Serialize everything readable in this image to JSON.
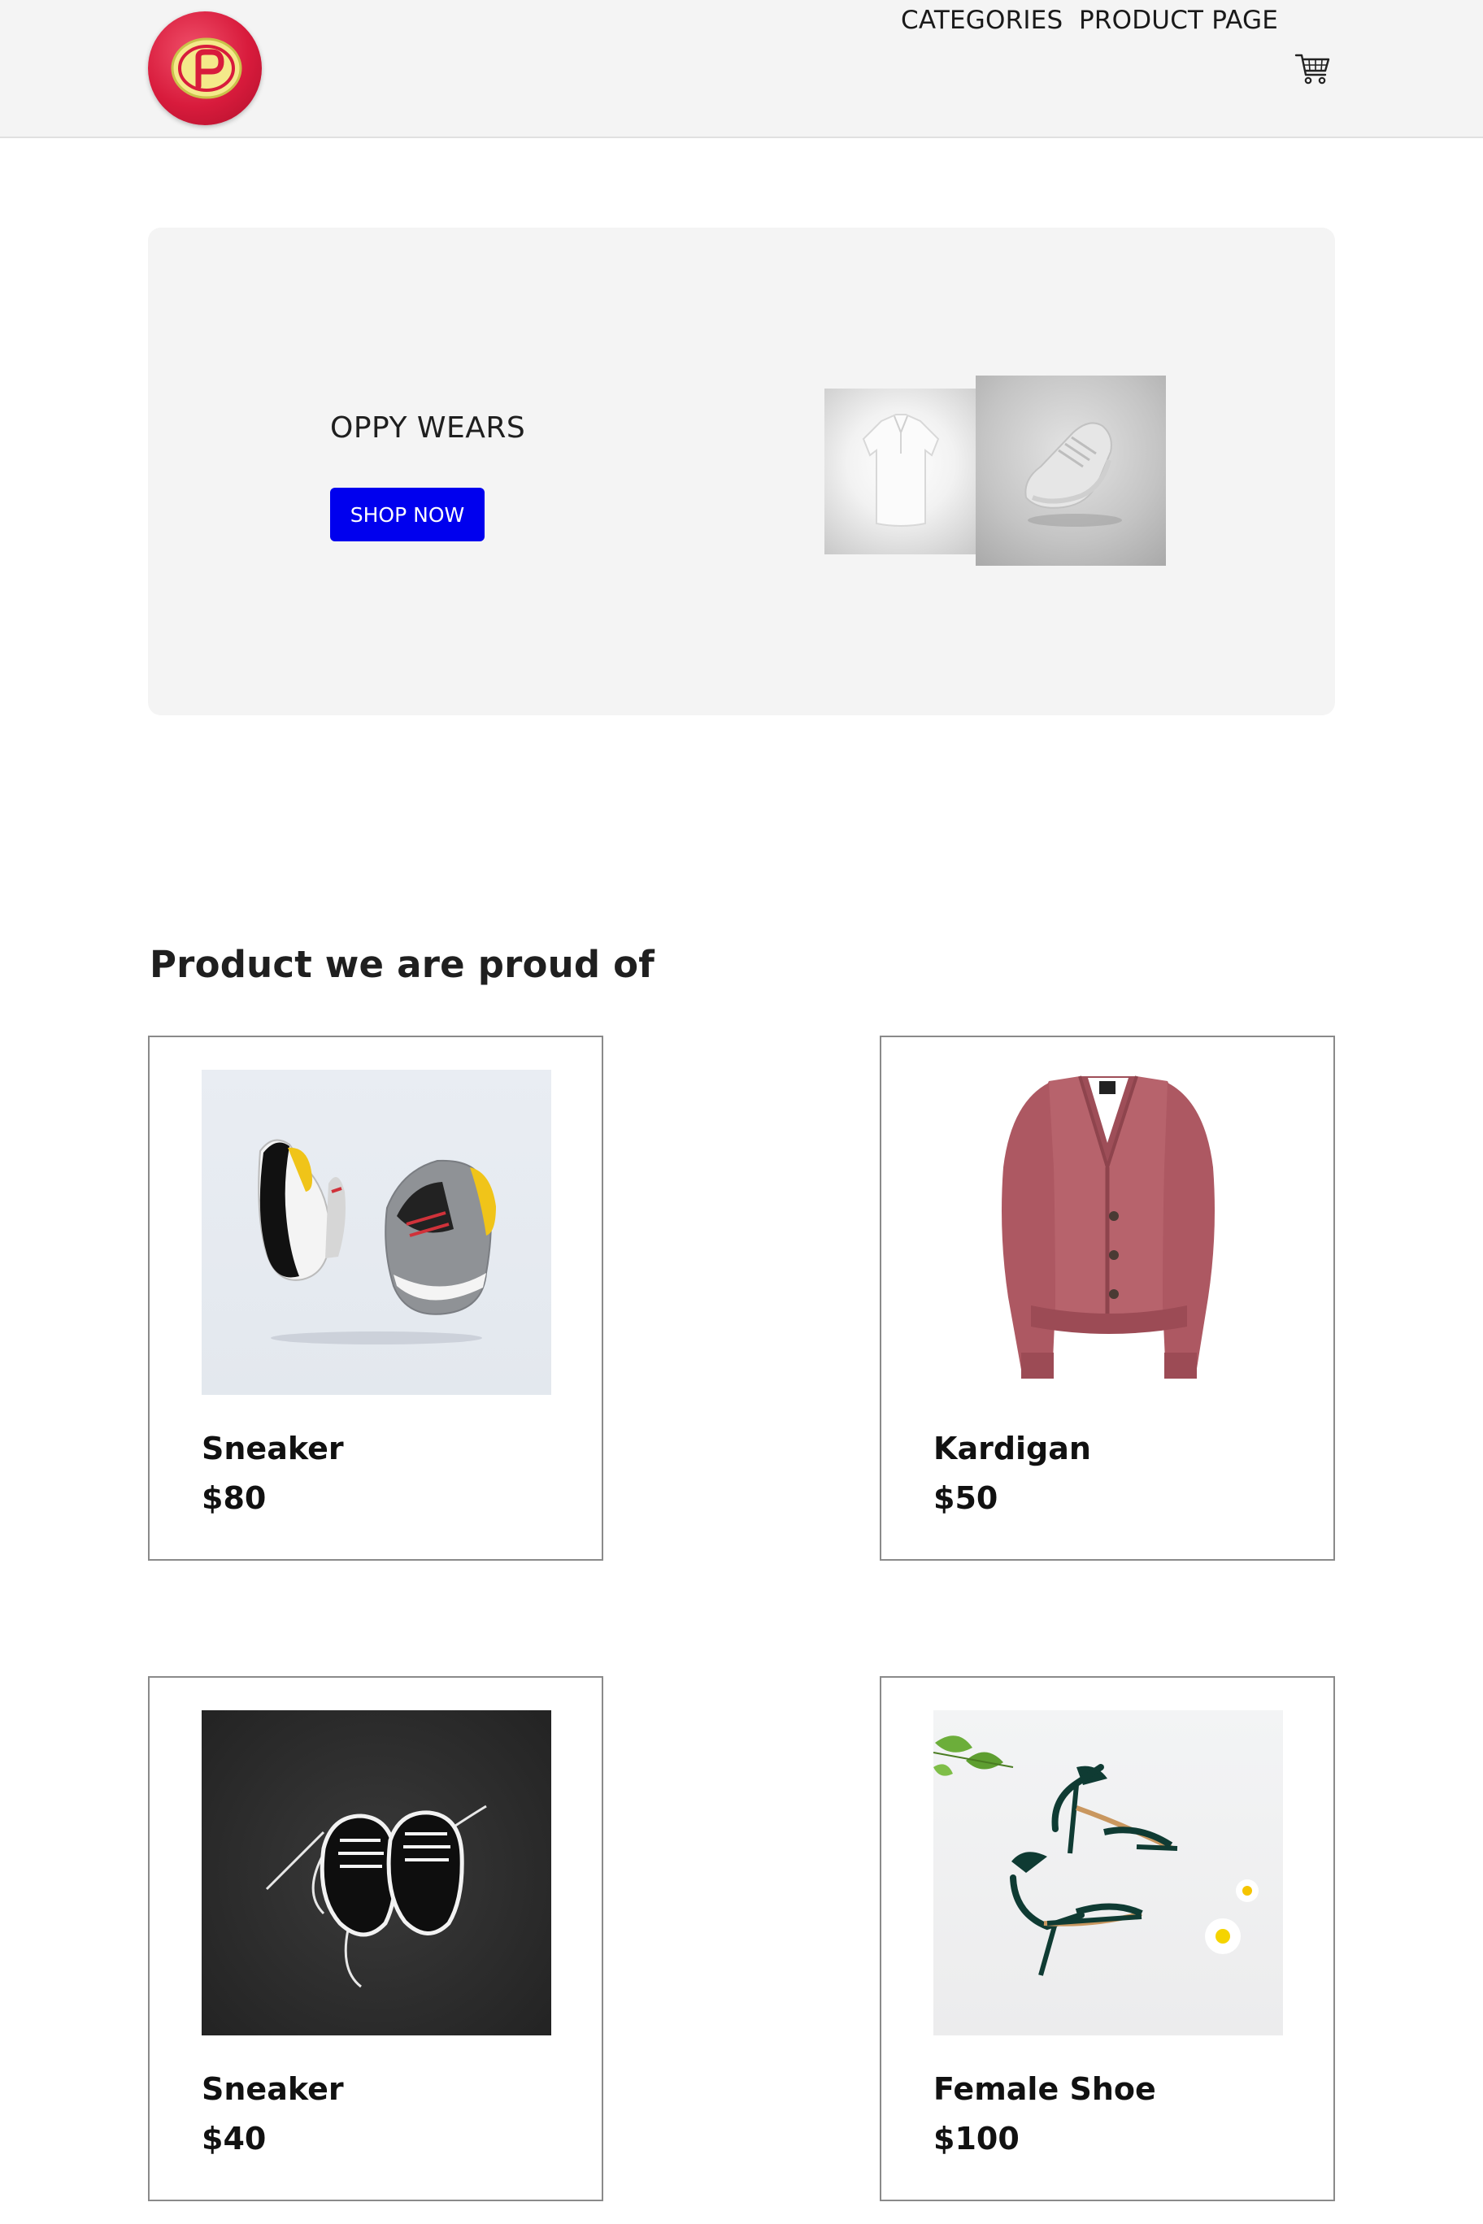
{
  "header": {
    "logo_alt": "P",
    "nav": {
      "categories": "CATEGORIES",
      "product_page": "PRODUCT PAGE"
    },
    "cart_icon": "shopping-cart-icon"
  },
  "hero": {
    "title": "OPPY WEARS",
    "button_label": "SHOP NOW",
    "button_color": "#0000ee",
    "images": [
      "white-polo-shirt",
      "grey-sneaker"
    ]
  },
  "products_section": {
    "title": "Product we are proud of",
    "products": [
      {
        "name": "Sneaker",
        "price": "$80",
        "image": "grey-yellow-sneakers"
      },
      {
        "name": "Kardigan",
        "price": "$50",
        "image": "pink-cardigan"
      },
      {
        "name": "Sneaker",
        "price": "$40",
        "image": "black-sneakers"
      },
      {
        "name": "Female Shoe",
        "price": "$100",
        "image": "green-heeled-sandals"
      }
    ]
  },
  "colors": {
    "header_bg": "#f4f4f4",
    "hero_bg": "#f4f4f4",
    "logo_red": "#d81b3c"
  }
}
